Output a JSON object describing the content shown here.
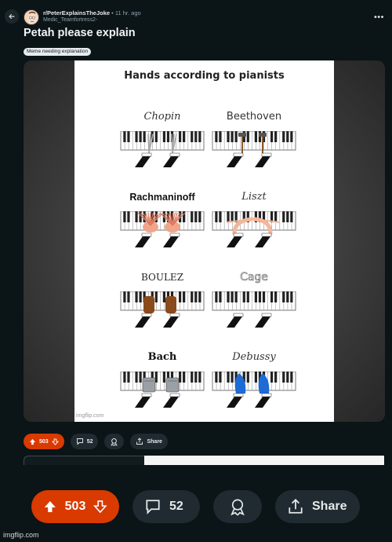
{
  "header": {
    "subreddit": "r/PeterExplainsTheJoke",
    "separator": "•",
    "time": "11 hr. ago",
    "username": "Medic_Teamfortress2-",
    "more": "•••"
  },
  "post": {
    "title": "Petah please explain",
    "flair": "Meme needing explanation"
  },
  "meme": {
    "title": "Hands according to pianists",
    "watermark": "imgflip.com",
    "cells": [
      {
        "name": "Chopin",
        "style": "script",
        "hands": "skeletal"
      },
      {
        "name": "Beethoven",
        "style": "plain",
        "hands": "hammers"
      },
      {
        "name": "Rachmaninoff",
        "style": "bold",
        "hands": "many-fingers"
      },
      {
        "name": "Liszt",
        "style": "script",
        "hands": "long-fingers"
      },
      {
        "name": "BOULEZ",
        "style": "caps",
        "hands": "fists"
      },
      {
        "name": "Cage",
        "style": "outline",
        "hands": "none"
      },
      {
        "name": "Bach",
        "style": "gothic",
        "hands": "robot"
      },
      {
        "name": "Debussy",
        "style": "script",
        "hands": "blue-flippers"
      }
    ]
  },
  "actions": {
    "score": "503",
    "comments": "52",
    "share": "Share"
  },
  "actions_large": {
    "score": "503",
    "comments": "52",
    "share": "Share"
  },
  "footer": {
    "watermark": "imgflip.com"
  },
  "colors": {
    "background": "#0b1416",
    "vote_pill": "#d93a00",
    "pill": "#1f2b30"
  }
}
